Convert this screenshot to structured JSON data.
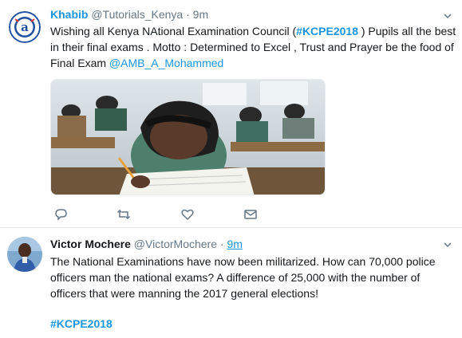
{
  "tweet1": {
    "author_name": "Khabib",
    "handle": "@Tutorials_Kenya",
    "separator": "·",
    "time": "9m",
    "text_parts": {
      "a": "Wishing all Kenya NAtional Examination Council (",
      "hashtag": "#KCPE2018",
      "b": " ) Pupils all the best in their final exams . Motto : Determined to Excel , Trust and Prayer be the food of Final Exam ",
      "mention": "@AMB_A_Mohammed"
    },
    "avatar_icon": "advanced-ed-logo-icon",
    "media_icon": "exam-classroom-photo",
    "actions": {
      "reply_icon": "reply-icon",
      "retweet_icon": "retweet-icon",
      "like_icon": "heart-icon",
      "dm_icon": "envelope-icon"
    }
  },
  "tweet2": {
    "author_name": "Victor Mochere",
    "handle": "@VictorMochere",
    "separator": "·",
    "time": "9m",
    "text": "The National Examinations have now been militarized. How can 70,000 police officers man the national exams? A difference of 25,000 with the number of officers that were manning the 2017 general elections!",
    "hashtag": "#KCPE2018",
    "avatar_icon": "user-photo-avatar"
  },
  "colors": {
    "link": "#1b95e0",
    "text": "#14171a",
    "muted": "#657786",
    "border": "#e6ecf0"
  }
}
